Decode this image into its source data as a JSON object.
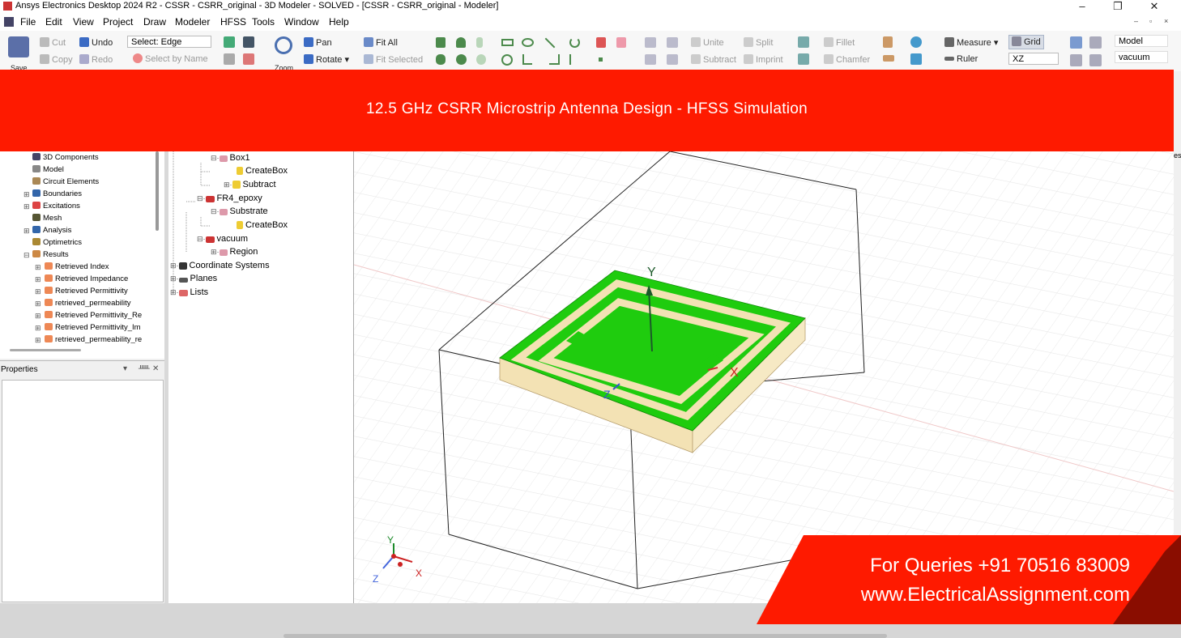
{
  "window": {
    "title": "Ansys Electronics Desktop 2024 R2 - CSSR - CSRR_original - 3D Modeler - SOLVED - [CSSR - CSRR_original - Modeler]",
    "minimize": "–",
    "restore": "❐",
    "close": "✕"
  },
  "menu": {
    "items": [
      "File",
      "Edit",
      "View",
      "Project",
      "Draw",
      "Modeler",
      "HFSS",
      "Tools",
      "Window",
      "Help"
    ],
    "mdi_controls": [
      "–",
      "▫",
      "×"
    ]
  },
  "ribbon": {
    "save": "Save",
    "cut": "Cut",
    "copy": "Copy",
    "undo": "Undo",
    "redo": "Redo",
    "select_mode": "Select: Edge",
    "select_by_name": "Select by Name",
    "zoom": "Zoom",
    "pan": "Pan",
    "rotate": "Rotate",
    "fit_all": "Fit All",
    "fit_selected": "Fit Selected",
    "unite": "Unite",
    "subtract": "Subtract",
    "split": "Split",
    "imprint": "Imprint",
    "fillet": "Fillet",
    "chamfer": "Chamfer",
    "measure": "Measure",
    "ruler": "Ruler",
    "grid": "Grid",
    "plane": "XZ",
    "model": "Model",
    "material": "vacuum"
  },
  "banner": {
    "text": "12.5 GHz CSRR Microstrip Antenna Design - HFSS Simulation"
  },
  "project_tree": {
    "items": [
      "3D Components",
      "Model",
      "Circuit Elements",
      "Boundaries",
      "Excitations",
      "Mesh",
      "Analysis",
      "Optimetrics",
      "Results",
      "Retrieved Index",
      "Retrieved Impedance",
      "Retrieved Permittivity",
      "retrieved_permeability",
      "Retrieved Permittivity_Re",
      "Retrieved Permittivity_Im",
      "retrieved_permeability_re"
    ]
  },
  "properties": {
    "title": "Properties",
    "controls": [
      "▾",
      "ᚊ",
      "✕"
    ]
  },
  "model_tree": {
    "items": [
      "Box1",
      "CreateBox",
      "Subtract",
      "FR4_epoxy",
      "Substrate",
      "CreateBox",
      "vacuum",
      "Region",
      "Coordinate Systems",
      "Planes",
      "Lists"
    ]
  },
  "viewport": {
    "axis_y": "Y",
    "axis_x": "X",
    "axis_z": "Z",
    "triad_y": "Y",
    "triad_x": "X",
    "triad_z": "Z",
    "side_tab": "es"
  },
  "footer": {
    "line1": "For Queries +91 70516 83009",
    "line2": "www.ElectricalAssignment.com"
  },
  "colors": {
    "banner": "#fe1a00",
    "copper": "#1fcc0e",
    "substrate": "#f3e2b4",
    "grid": "#e3e3e3"
  }
}
